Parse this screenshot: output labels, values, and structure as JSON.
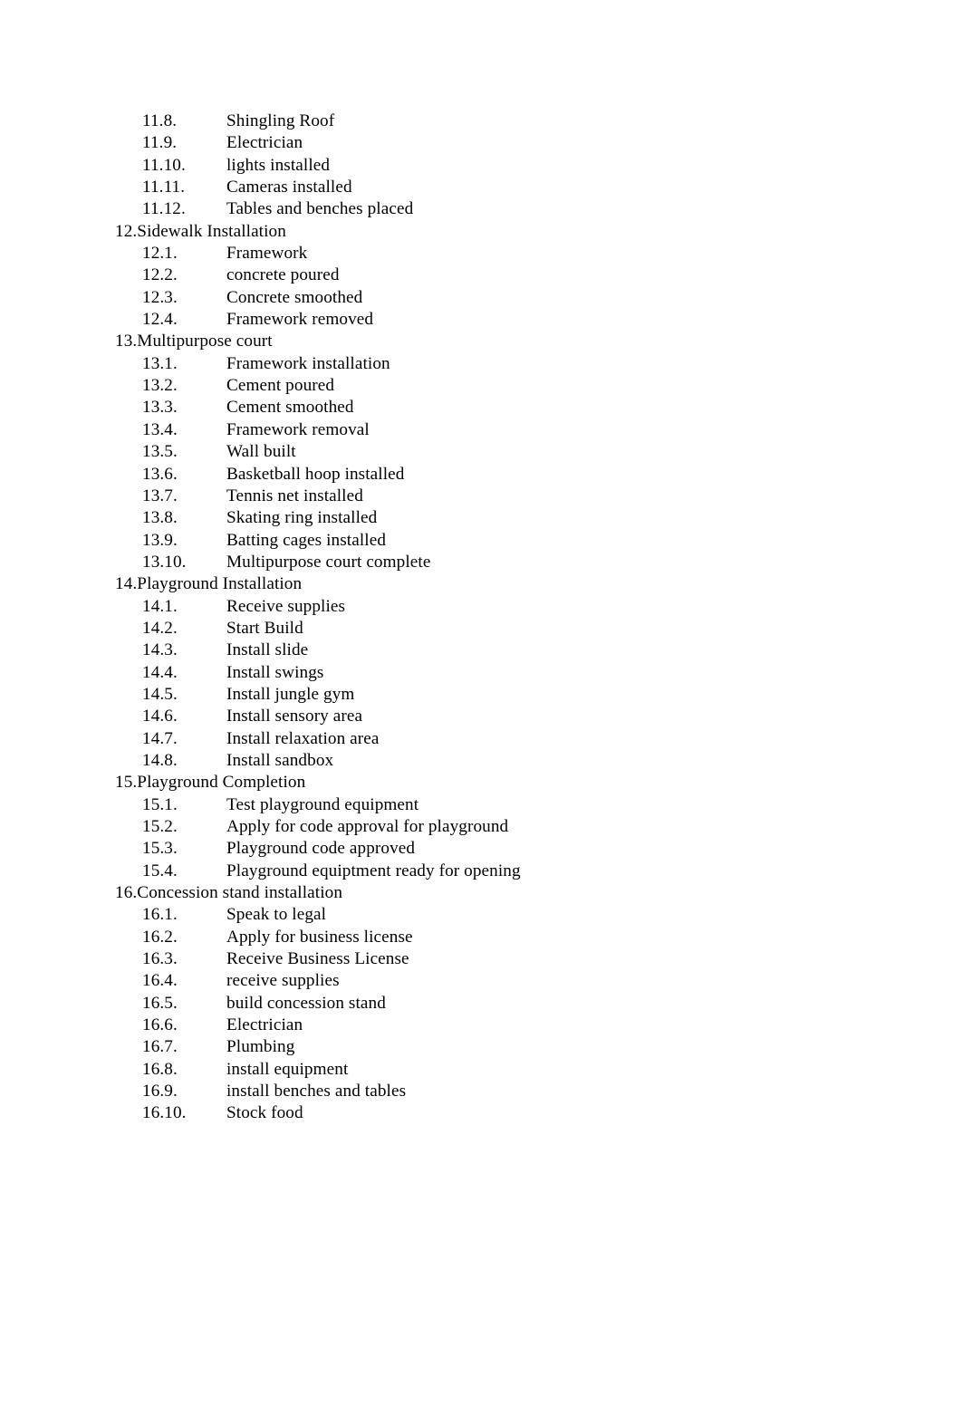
{
  "document": {
    "page_background": "#ffffff",
    "text_color": "#000000",
    "sections": [
      {
        "number": "11.",
        "title": null,
        "continued": true,
        "items": [
          {
            "number": "11.8.",
            "text": "Shingling Roof"
          },
          {
            "number": "11.9.",
            "text": "Electrician"
          },
          {
            "number": "11.10.",
            "text": "lights installed"
          },
          {
            "number": "11.11.",
            "text": "Cameras installed"
          },
          {
            "number": "11.12.",
            "text": "Tables and benches placed"
          }
        ]
      },
      {
        "number": "12.",
        "title": "Sidewalk Installation",
        "continued": false,
        "items": [
          {
            "number": "12.1.",
            "text": "Framework"
          },
          {
            "number": "12.2.",
            "text": "concrete poured"
          },
          {
            "number": "12.3.",
            "text": "Concrete smoothed"
          },
          {
            "number": "12.4.",
            "text": "Framework removed"
          }
        ]
      },
      {
        "number": "13.",
        "title": "Multipurpose court",
        "continued": false,
        "items": [
          {
            "number": "13.1.",
            "text": "Framework installation"
          },
          {
            "number": "13.2.",
            "text": "Cement poured"
          },
          {
            "number": "13.3.",
            "text": "Cement smoothed"
          },
          {
            "number": "13.4.",
            "text": "Framework removal"
          },
          {
            "number": "13.5.",
            "text": "Wall built"
          },
          {
            "number": "13.6.",
            "text": "Basketball hoop installed"
          },
          {
            "number": "13.7.",
            "text": "Tennis net installed"
          },
          {
            "number": "13.8.",
            "text": "Skating ring installed"
          },
          {
            "number": "13.9.",
            "text": "Batting cages installed"
          },
          {
            "number": "13.10.",
            "text": "Multipurpose court complete"
          }
        ]
      },
      {
        "number": "14.",
        "title": "Playground Installation",
        "continued": false,
        "items": [
          {
            "number": "14.1.",
            "text": "Receive supplies"
          },
          {
            "number": "14.2.",
            "text": "Start Build"
          },
          {
            "number": "14.3.",
            "text": "Install slide"
          },
          {
            "number": "14.4.",
            "text": "Install swings"
          },
          {
            "number": "14.5.",
            "text": "Install jungle gym"
          },
          {
            "number": "14.6.",
            "text": "Install sensory area"
          },
          {
            "number": "14.7.",
            "text": "Install relaxation area"
          },
          {
            "number": "14.8.",
            "text": "Install sandbox"
          }
        ]
      },
      {
        "number": "15.",
        "title": "Playground Completion",
        "continued": false,
        "items": [
          {
            "number": "15.1.",
            "text": "Test playground equipment"
          },
          {
            "number": "15.2.",
            "text": "Apply for code approval for playground"
          },
          {
            "number": "15.3.",
            "text": "Playground code approved"
          },
          {
            "number": "15.4.",
            "text": "Playground equiptment ready for opening"
          }
        ]
      },
      {
        "number": "16.",
        "title": "Concession stand installation",
        "continued": false,
        "items": [
          {
            "number": "16.1.",
            "text": "Speak to legal"
          },
          {
            "number": "16.2.",
            "text": "Apply for business license"
          },
          {
            "number": "16.3.",
            "text": "Receive Business License"
          },
          {
            "number": "16.4.",
            "text": "receive supplies"
          },
          {
            "number": "16.5.",
            "text": "build concession stand"
          },
          {
            "number": "16.6.",
            "text": "Electrician"
          },
          {
            "number": "16.7.",
            "text": "Plumbing"
          },
          {
            "number": "16.8.",
            "text": "install equipment"
          },
          {
            "number": "16.9.",
            "text": "install benches and tables"
          },
          {
            "number": "16.10.",
            "text": "Stock food"
          }
        ]
      }
    ]
  }
}
